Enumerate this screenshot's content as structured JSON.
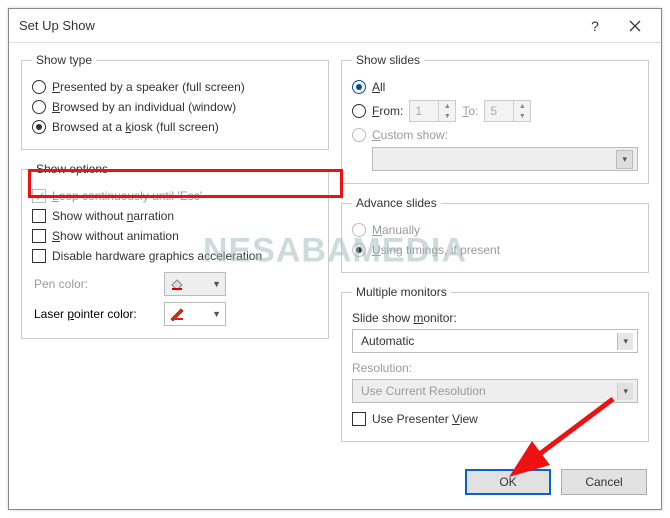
{
  "dialog": {
    "title": "Set Up Show"
  },
  "show_type": {
    "legend": "Show type",
    "options": [
      {
        "label": "Presented by a speaker (full screen)",
        "u": "P",
        "selected": false
      },
      {
        "label": "Browsed by an individual (window)",
        "u": "B",
        "selected": false
      },
      {
        "label": "Browsed at a kiosk (full screen)",
        "u": "k",
        "selected": true
      }
    ]
  },
  "show_options": {
    "legend": "Show options",
    "items": [
      {
        "label": "Loop continuously until 'Esc'",
        "u": "L",
        "checked": true,
        "disabled": true
      },
      {
        "label": "Show without narration",
        "u": "n",
        "checked": false,
        "disabled": false
      },
      {
        "label": "Show without animation",
        "u": "S",
        "checked": false,
        "disabled": false
      },
      {
        "label": "Disable hardware graphics acceleration",
        "u": "g",
        "checked": false,
        "disabled": false
      }
    ],
    "pen_label": "Pen color:",
    "laser_label": "Laser pointer color:",
    "laser_u": "p"
  },
  "show_slides": {
    "legend": "Show slides",
    "all_label": "All",
    "all_u": "A",
    "from_label": "From:",
    "from_u": "F",
    "from_val": "1",
    "to_label": "To:",
    "to_u": "T",
    "to_val": "5",
    "custom_label": "Custom show:",
    "custom_u": "C"
  },
  "advance": {
    "legend": "Advance slides",
    "manual_label": "Manually",
    "manual_u": "M",
    "timings_label": "Using timings, if present",
    "timings_u": "U"
  },
  "monitors": {
    "legend": "Multiple monitors",
    "monitor_label": "Slide show monitor:",
    "monitor_u": "m",
    "monitor_value": "Automatic",
    "resolution_label": "Resolution:",
    "resolution_value": "Use Current Resolution",
    "presenter_label": "Use Presenter View",
    "presenter_u": "V"
  },
  "buttons": {
    "ok": "OK",
    "cancel": "Cancel"
  },
  "watermark": "NESABAMEDIA"
}
